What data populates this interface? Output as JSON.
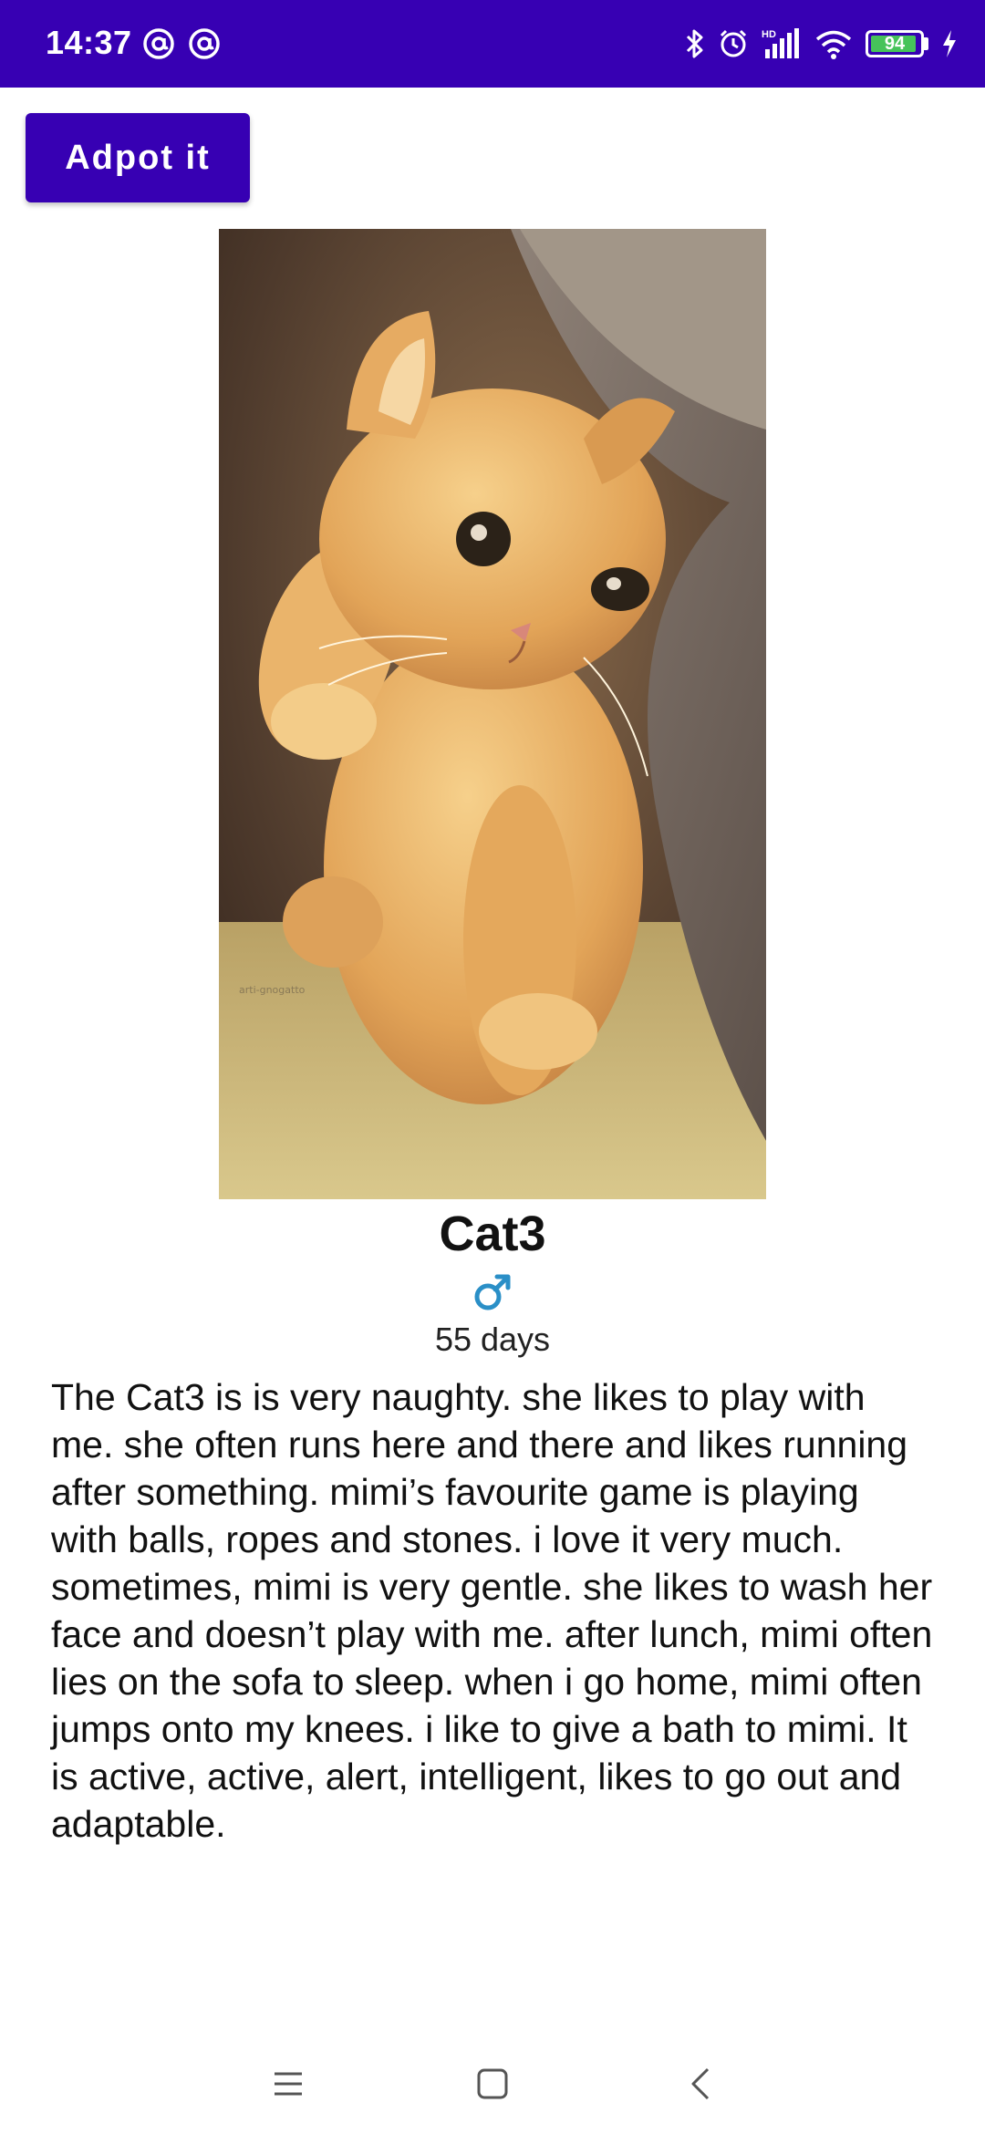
{
  "status_bar": {
    "time": "14:37",
    "battery_level": "94",
    "battery_fraction": 0.94,
    "signal_label": "HD",
    "left_icons": [
      "at-sign-icon",
      "at-sign-icon"
    ],
    "right_icons": [
      "bluetooth-icon",
      "alarm-icon",
      "signal-icon",
      "wifi-icon",
      "battery-icon",
      "charging-icon"
    ],
    "background_color": "#3700b3"
  },
  "action": {
    "adopt_label": "Adpot it",
    "button_color": "#3700b3"
  },
  "pet": {
    "photo_icon": "cat-photo",
    "photo_watermark": "arti-gnogatto",
    "name": "Cat3",
    "gender_symbol": "♂",
    "gender_color": "#2a8fc7",
    "age": "55 days",
    "description": "The Cat3 is is very naughty. she likes to play with me. she often runs here and there and likes running after something. mimi’s favourite game is playing with balls, ropes and stones. i love it very much. sometimes, mimi is very gentle. she likes to wash her face and doesn’t play with me. after lunch, mimi often lies on the sofa to sleep. when i go home, mimi often jumps onto my knees. i like to give a bath to mimi. It is active, active, alert, intelligent, likes to go out and adaptable."
  },
  "navigation": {
    "icons": [
      "menu-icon",
      "home-icon",
      "back-icon"
    ]
  }
}
